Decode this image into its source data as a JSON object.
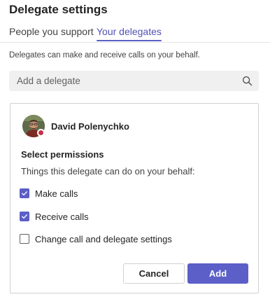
{
  "header": {
    "title": "Delegate settings"
  },
  "tabs": [
    {
      "label": "People you support",
      "active": false
    },
    {
      "label": "Your delegates",
      "active": true
    }
  ],
  "description": "Delegates can make and receive calls on your behalf.",
  "search": {
    "placeholder": "Add a delegate",
    "value": "",
    "icon": "search-icon"
  },
  "delegate_card": {
    "person": {
      "name": "David Polenychko",
      "presence": "busy",
      "presence_color": "#c4314b"
    },
    "permissions_title": "Select permissions",
    "permissions_subtitle": "Things this delegate can do on your behalf:",
    "permissions": [
      {
        "label": "Make calls",
        "checked": true
      },
      {
        "label": "Receive calls",
        "checked": true
      },
      {
        "label": "Change call and delegate settings",
        "checked": false
      }
    ],
    "buttons": {
      "cancel": "Cancel",
      "add": "Add"
    }
  },
  "colors": {
    "accent": "#5b5fc7",
    "accent_text": "#4f52b2",
    "busy": "#c4314b"
  }
}
